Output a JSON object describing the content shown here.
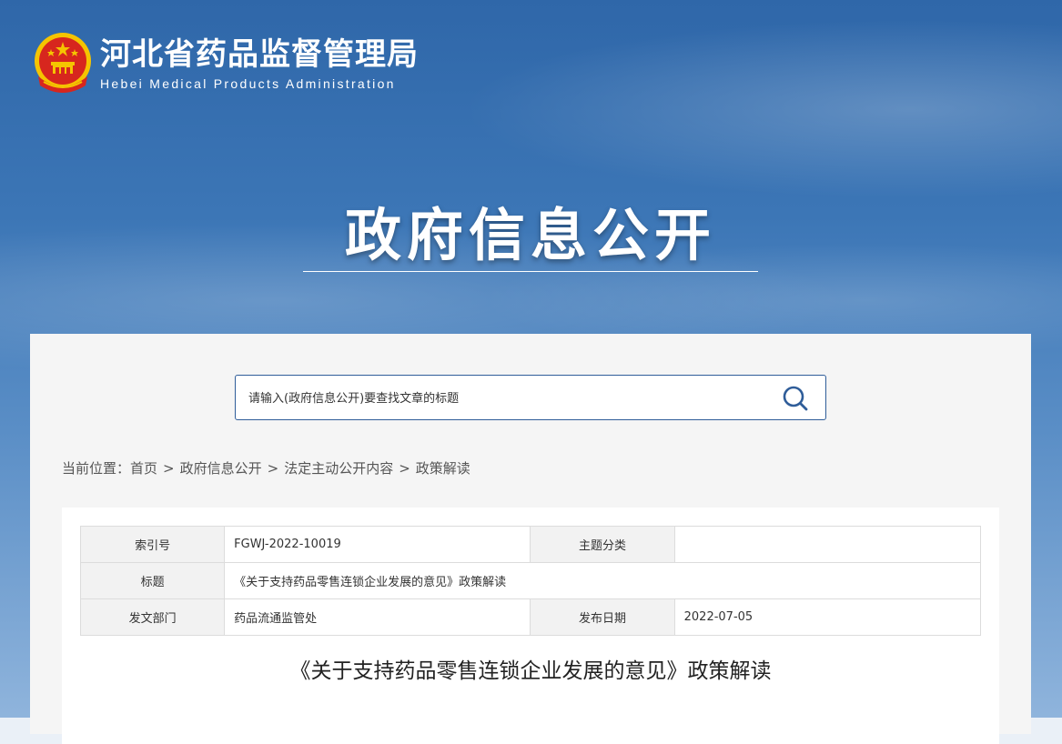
{
  "header": {
    "site_title": "河北省药品监督管理局",
    "site_subtitle": "Hebei Medical Products Administration",
    "emblem_icon": "national-emblem-icon"
  },
  "hero": {
    "title": "政府信息公开"
  },
  "search": {
    "placeholder": "请输入(政府信息公开)要查找文章的标题",
    "icon": "search-icon"
  },
  "breadcrumb": {
    "prefix": "当前位置：",
    "items": [
      "首页",
      "政府信息公开",
      "法定主动公开内容",
      "政策解读"
    ],
    "separator": ">"
  },
  "meta": {
    "index_label": "索引号",
    "index_value": "FGWJ-2022-10019",
    "category_label": "主题分类",
    "category_value": "",
    "title_label": "标题",
    "title_value": "《关于支持药品零售连锁企业发展的意见》政策解读",
    "dept_label": "发文部门",
    "dept_value": "药品流通监管处",
    "date_label": "发布日期",
    "date_value": "2022-07-05"
  },
  "article": {
    "title": "《关于支持药品零售连锁企业发展的意见》政策解读"
  },
  "colors": {
    "hero_top": "#2f67a9",
    "hero_bottom": "#8fb4dc",
    "search_border": "#2f5d99",
    "emblem_red": "#d7261e",
    "emblem_gold": "#f5c400"
  }
}
